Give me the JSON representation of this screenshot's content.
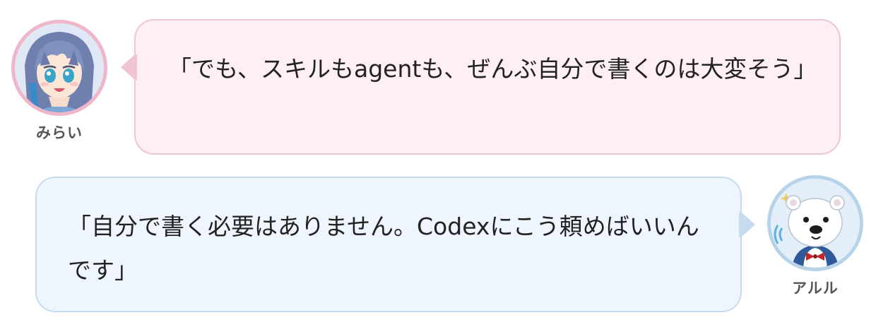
{
  "messages": [
    {
      "speaker": "みらい",
      "text": "「でも、スキルもagentも、ぜんぶ自分で書くのは大変そう」",
      "side": "left",
      "bubble_bg": "#fdeff4",
      "bubble_border": "#f0c5d3",
      "avatar_border": "#eeb6c8"
    },
    {
      "speaker": "アルル",
      "text": "「自分で書く必要はありません。Codexにこう頼めばいいんです」",
      "side": "right",
      "bubble_bg": "#eef5fc",
      "bubble_border": "#c6dcee",
      "avatar_border": "#b7d3ea"
    }
  ]
}
